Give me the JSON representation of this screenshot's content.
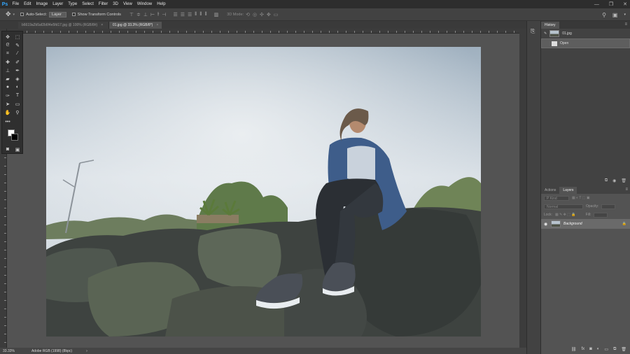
{
  "app": {
    "logo": "Ps"
  },
  "menu": [
    "File",
    "Edit",
    "Image",
    "Layer",
    "Type",
    "Select",
    "Filter",
    "3D",
    "View",
    "Window",
    "Help"
  ],
  "window_controls": [
    "—",
    "❐",
    "✕"
  ],
  "options_bar": {
    "auto_select_label": "Auto-Select:",
    "auto_select_value": "Layer",
    "transform_label": "Show Transform Controls",
    "mode_label": "3D Mode:"
  },
  "tabs": [
    {
      "label": "b6619a2b5af2b6f4e5fd17.jpg @ 100% (RGB/8#)",
      "close": "×"
    },
    {
      "label": "01.jpg @ 33.3% (RGB/8*)",
      "close": "×"
    }
  ],
  "status": {
    "zoom": "33.33%",
    "profile": "Adobe RGB (1998) (8bpc)"
  },
  "history": {
    "tab": "History",
    "items": [
      {
        "label": "01.jpg"
      },
      {
        "label": "Open"
      }
    ]
  },
  "layers": {
    "tabs": [
      "Actions",
      "Layers"
    ],
    "kind_placeholder": "P Kind",
    "blend_mode": "Normal",
    "opacity_label": "Opacity:",
    "lock_label": "Lock:",
    "fill_label": "Fill:",
    "items": [
      {
        "name": "Background"
      }
    ]
  },
  "colors": {
    "foreground": "#ffffff",
    "background": "#000000",
    "accent": "#33a8ff"
  }
}
